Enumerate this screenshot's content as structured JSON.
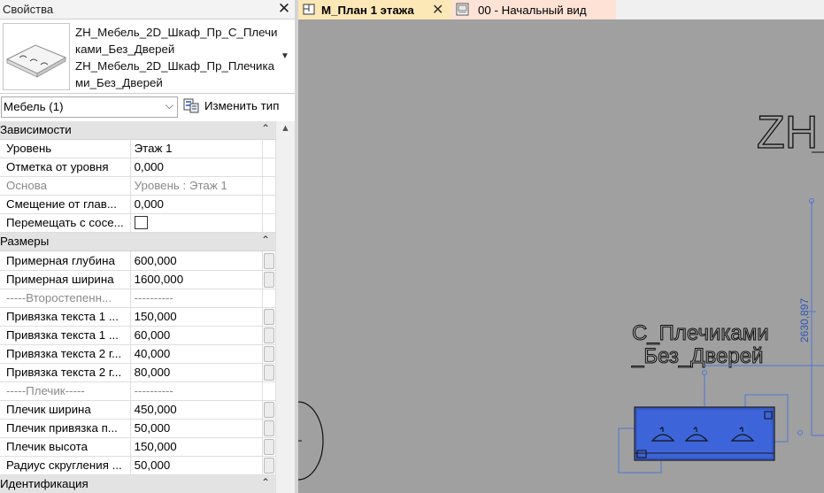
{
  "properties": {
    "title": "Свойства",
    "close_glyph": "✕",
    "family_lines": [
      "ZH_Мебель_2D_Шкаф_Пр_С_Плечи",
      "ками_Без_Дверей",
      "ZH_Мебель_2D_Шкаф_Пр_Плечика",
      "ми_Без_Дверей"
    ],
    "type_selector": "Мебель (1)",
    "edit_type_label": "Изменить тип",
    "groups": {
      "constraints": "Зависимости",
      "dimensions": "Размеры",
      "identity": "Идентификация"
    },
    "rows": [
      {
        "name": "Уровень",
        "value": "Этаж 1"
      },
      {
        "name": "Отметка от уровня",
        "value": "0,000"
      },
      {
        "name": "Основа",
        "value": "Уровень : Этаж 1"
      },
      {
        "name": "Смещение от глав...",
        "value": "0,000"
      },
      {
        "name": "Перемещать с сосе...",
        "value": ""
      },
      {
        "name": "Примерная глубина",
        "value": "600,000"
      },
      {
        "name": "Примерная ширина",
        "value": "1600,000"
      },
      {
        "name": "-----Второстепенн...",
        "value": "----------"
      },
      {
        "name": "Привязка текста 1 ...",
        "value": "150,000"
      },
      {
        "name": "Привязка текста 1 ...",
        "value": "60,000"
      },
      {
        "name": "Привязка текста 2 г...",
        "value": "40,000"
      },
      {
        "name": "Привязка текста 2 г...",
        "value": "80,000"
      },
      {
        "name": "-----Плечик-----",
        "value": "----------"
      },
      {
        "name": "Плечик ширина",
        "value": "450,000"
      },
      {
        "name": "Плечик привязка п...",
        "value": "50,000"
      },
      {
        "name": "Плечик высота",
        "value": "150,000"
      },
      {
        "name": "Радиус скругления ...",
        "value": "50,000"
      }
    ]
  },
  "tabs": [
    {
      "label": "М_План 1 этажа",
      "active": true
    },
    {
      "label": "00 - Начальный вид",
      "active": false
    }
  ],
  "drawing": {
    "big_text": "ZH",
    "label_line1": "С_Плечиками",
    "label_line2": "_Без_Дверей",
    "dimension": "2630,897"
  },
  "colors": {
    "selection_blue": "#3d64d8",
    "canvas_gray": "#a0a0a0",
    "active_tab": "#fbe8b6"
  }
}
